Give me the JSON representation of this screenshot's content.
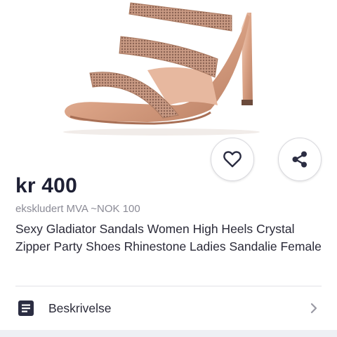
{
  "listing": {
    "price": "kr 400",
    "vat_note": "ekskludert MVA ~NOK 100",
    "title": "Sexy Gladiator Sandals Women High Heels Crystal Zipper Party Shoes Rhinestone Ladies Sandalie Female"
  },
  "actions": {
    "favorite_icon": "heart-icon",
    "share_icon": "share-icon"
  },
  "description_row": {
    "label": "Beskrivelse",
    "icon": "document-icon",
    "chevron_icon": "chevron-right-icon"
  },
  "colors": {
    "price": "#1e2034",
    "secondary_text": "#8b8b96",
    "icon": "#2b2d42",
    "chevron": "#9a9aa4",
    "bottom_band": "#eef0f4"
  }
}
